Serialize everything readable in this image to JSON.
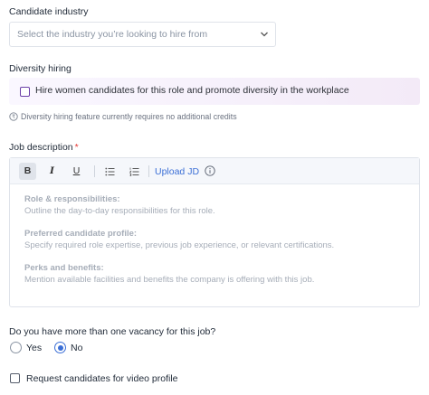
{
  "industry": {
    "label": "Candidate industry",
    "placeholder": "Select the industry you’re looking to hire from"
  },
  "diversity": {
    "label": "Diversity hiring",
    "checkbox_label": "Hire women candidates for this role and promote diversity in the workplace",
    "checked": false,
    "note": "Diversity hiring feature currently requires no additional credits"
  },
  "job_description": {
    "label": "Job description",
    "required_mark": "*",
    "toolbar": {
      "bold": "B",
      "italic": "I",
      "underline": "U",
      "upload_label": "Upload JD"
    },
    "placeholder": [
      {
        "heading": "Role & responsibilities:",
        "text": "Outline the day-to-day responsibilities for this role."
      },
      {
        "heading": "Preferred candidate profile:",
        "text": "Specify required role expertise, previous job experience, or relevant certifications."
      },
      {
        "heading": "Perks and benefits:",
        "text": "Mention available facilities and benefits the company is offering with this job."
      }
    ]
  },
  "vacancy": {
    "question": "Do you have more than one vacancy for this job?",
    "options": [
      "Yes",
      "No"
    ],
    "selected": "No"
  },
  "video_profile": {
    "label": "Request candidates for video profile",
    "checked": false
  },
  "colors": {
    "accent": "#3b6fd6",
    "required": "#e53935",
    "diversity_bg": "#f6f0fb"
  }
}
